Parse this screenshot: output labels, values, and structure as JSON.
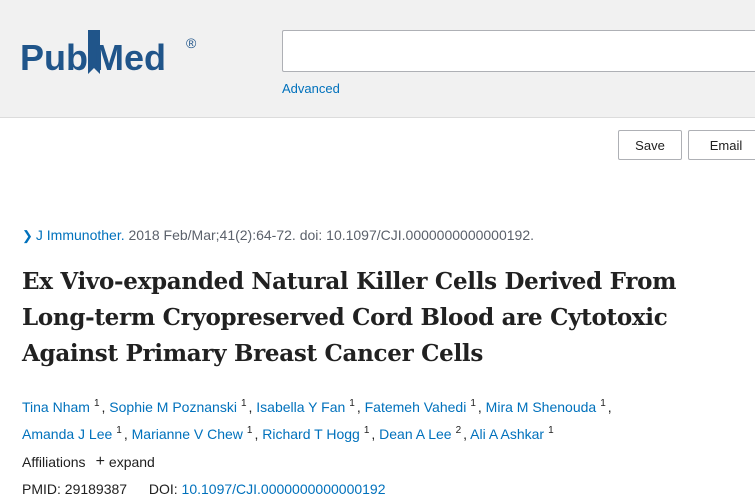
{
  "header": {
    "logo_text_pub": "Pub",
    "logo_text_med": "Med",
    "logo_reg": "®",
    "search_value": "",
    "advanced_label": "Advanced"
  },
  "actions": {
    "save_label": "Save",
    "email_label": "Email"
  },
  "citation": {
    "journal": "J Immunother.",
    "details": " 2018 Feb/Mar;41(2):64-72. doi: 10.1097/CJI.0000000000000192."
  },
  "article": {
    "title_line1": "Ex Vivo-expanded Natural Killer Cells Derived From",
    "title_line2": "Long-term Cryopreserved Cord Blood are Cytotoxic",
    "title_line3": "Against Primary Breast Cancer Cells"
  },
  "authors": [
    {
      "name": "Tina Nham",
      "aff": "1"
    },
    {
      "name": "Sophie M Poznanski",
      "aff": "1"
    },
    {
      "name": "Isabella Y Fan",
      "aff": "1"
    },
    {
      "name": "Fatemeh Vahedi",
      "aff": "1"
    },
    {
      "name": "Mira M Shenouda",
      "aff": "1"
    },
    {
      "name": "Amanda J Lee",
      "aff": "1"
    },
    {
      "name": "Marianne V Chew",
      "aff": "1"
    },
    {
      "name": "Richard T Hogg",
      "aff": "1"
    },
    {
      "name": "Dean A Lee",
      "aff": "2"
    },
    {
      "name": "Ali A Ashkar",
      "aff": "1"
    }
  ],
  "affiliations": {
    "label": "Affiliations",
    "expand_label": "expand"
  },
  "identifiers": {
    "pmid_label": "PMID:",
    "pmid_value": "29189387",
    "doi_label": "DOI:",
    "doi_value": "10.1097/CJI.0000000000000192"
  },
  "colors": {
    "link": "#0071bc",
    "pub": "#20558a",
    "med": "#20558a",
    "header_bg": "#f1f1f1"
  }
}
